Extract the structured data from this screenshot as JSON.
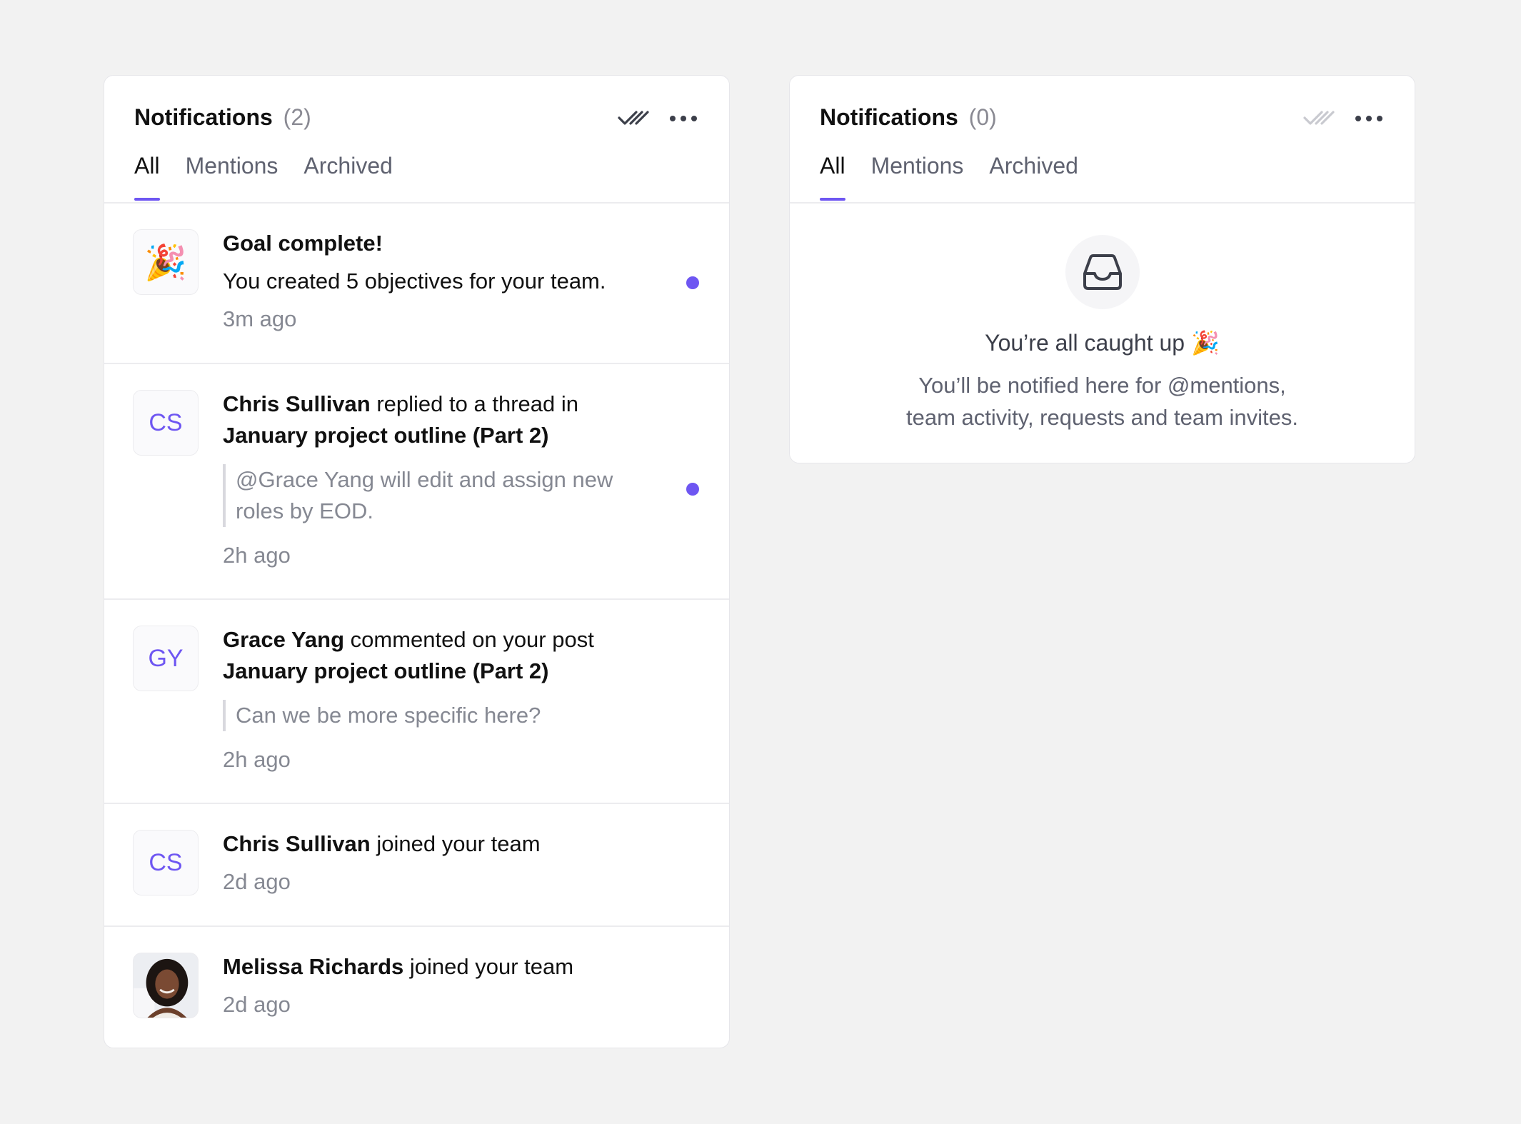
{
  "left_panel": {
    "title": "Notifications",
    "count": "(2)",
    "tabs": [
      "All",
      "Mentions",
      "Archived"
    ],
    "items": [
      {
        "avatar_emoji": "🎉",
        "title": "Goal complete!",
        "text": "You created 5 objectives for your team.",
        "time": "3m ago",
        "unread": true
      },
      {
        "avatar_initials": "CS",
        "actor": "Chris Sullivan",
        "action": " replied to a thread in",
        "target": "January project outline (Part 2)",
        "quote": "@Grace Yang will edit and assign new roles by EOD.",
        "time": "2h ago",
        "unread": true
      },
      {
        "avatar_initials": "GY",
        "actor": "Grace Yang",
        "action": " commented on your post",
        "target": "January project outline (Part 2)",
        "quote": "Can we be more specific here?",
        "time": "2h ago"
      },
      {
        "avatar_initials": "CS",
        "actor": "Chris Sullivan",
        "action": " joined your team",
        "time": "2d ago"
      },
      {
        "actor": "Melissa Richards",
        "action": " joined your team",
        "time": "2d ago"
      }
    ]
  },
  "right_panel": {
    "title": "Notifications",
    "count": "(0)",
    "tabs": [
      "All",
      "Mentions",
      "Archived"
    ],
    "empty_title": "You’re all caught up 🎉",
    "empty_desc_line1": "You’ll be notified here for @mentions,",
    "empty_desc_line2": "team activity, requests and team invites."
  },
  "colors": {
    "accent": "#6e56f2",
    "background": "#f2f2f2"
  }
}
